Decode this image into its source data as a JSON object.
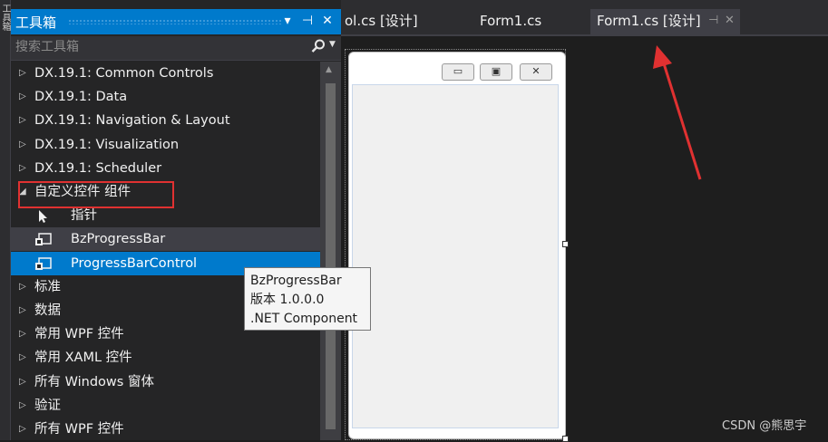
{
  "colors": {
    "accent": "#007acc",
    "panel": "#252526",
    "editor": "#1e1e1e",
    "annotation_red": "#e03131"
  },
  "left_strip": {
    "text": "工具箱"
  },
  "toolbox": {
    "title": "工具箱",
    "buttons": {
      "dropdown": "▾",
      "pin": "⊣",
      "close": "✕"
    },
    "search_placeholder": "搜索工具箱",
    "tree": [
      {
        "type": "group",
        "label": "DX.19.1: Common Controls",
        "expanded": false
      },
      {
        "type": "group",
        "label": "DX.19.1: Data",
        "expanded": false
      },
      {
        "type": "group",
        "label": "DX.19.1: Navigation & Layout",
        "expanded": false
      },
      {
        "type": "group",
        "label": "DX.19.1: Visualization",
        "expanded": false
      },
      {
        "type": "group",
        "label": "DX.19.1: Scheduler",
        "expanded": false
      },
      {
        "type": "group",
        "label": "自定义控件 组件",
        "expanded": true
      },
      {
        "type": "item",
        "label": "指针",
        "icon": "pointer-icon"
      },
      {
        "type": "item",
        "label": "BzProgressBar",
        "icon": "component-icon",
        "state": "hover"
      },
      {
        "type": "item",
        "label": "ProgressBarControl",
        "icon": "component-icon",
        "state": "selected"
      },
      {
        "type": "group",
        "label": "标准",
        "expanded": false
      },
      {
        "type": "group",
        "label": "数据",
        "expanded": false
      },
      {
        "type": "group",
        "label": "常用 WPF 控件",
        "expanded": false
      },
      {
        "type": "group",
        "label": "常用 XAML 控件",
        "expanded": false
      },
      {
        "type": "group",
        "label": "所有 Windows 窗体",
        "expanded": false
      },
      {
        "type": "group",
        "label": "验证",
        "expanded": false
      },
      {
        "type": "group",
        "label": "所有 WPF 控件",
        "expanded": false
      }
    ]
  },
  "tabs": [
    {
      "label": "ol.cs [设计]",
      "active": false
    },
    {
      "label": "Form1.cs",
      "active": false
    },
    {
      "label": "Form1.cs [设计]",
      "active": true,
      "pin": "⊣",
      "close": "✕"
    }
  ],
  "form_window": {
    "min": "▭",
    "max": "▣",
    "close": "✕"
  },
  "tooltip": {
    "line1": "BzProgressBar",
    "line2": "版本 1.0.0.0",
    "line3": ".NET Component"
  },
  "watermark": "CSDN @熊思宇"
}
